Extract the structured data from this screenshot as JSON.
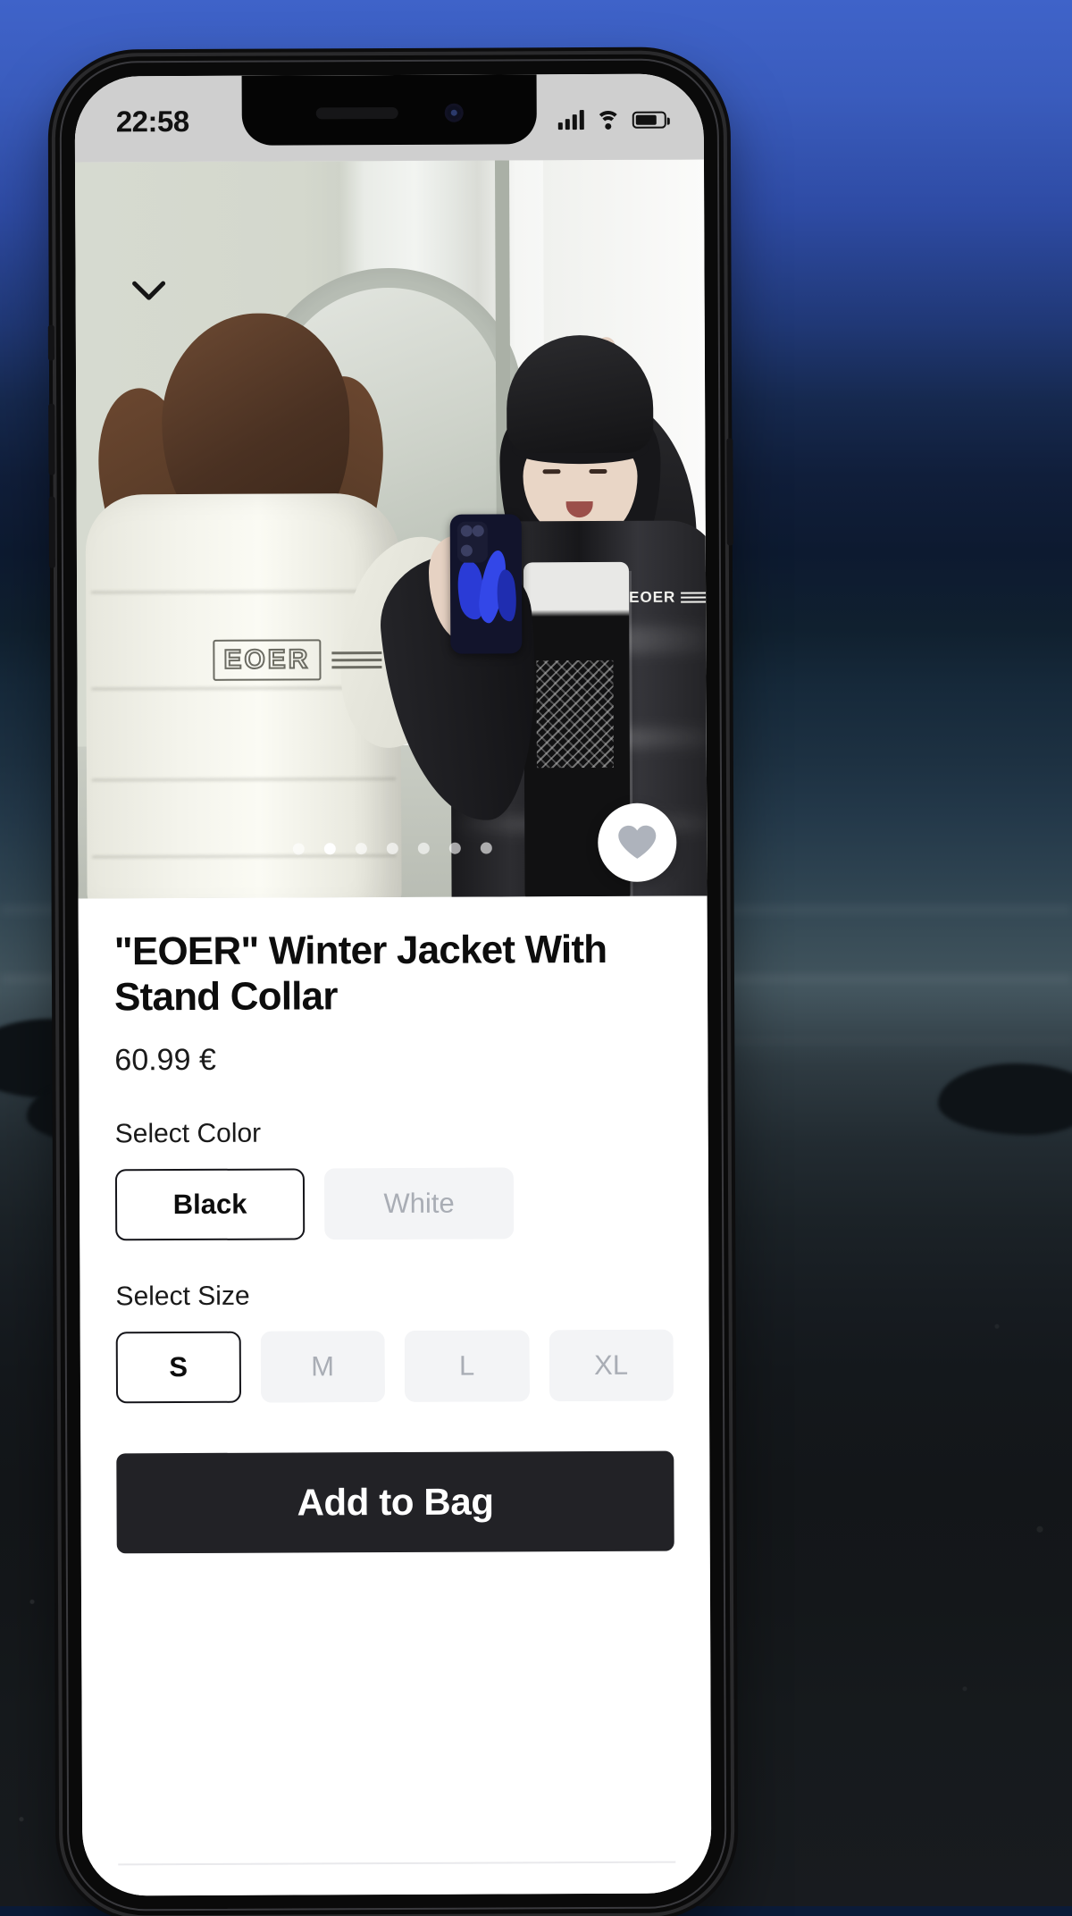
{
  "status_bar": {
    "time": "22:58",
    "signal_icon": "cellular-signal-icon",
    "wifi_icon": "wifi-icon",
    "battery_icon": "battery-icon"
  },
  "hero": {
    "back_icon": "chevron-down-icon",
    "favorite_icon": "heart-icon",
    "carousel": {
      "total": 7,
      "active_index": 1
    }
  },
  "product": {
    "title": "\"EOER\" Winter Jacket With Stand Collar",
    "price": "60.99 €",
    "brand_mark": "EOER",
    "color": {
      "label": "Select Color",
      "options": [
        {
          "label": "Black",
          "selected": true
        },
        {
          "label": "White",
          "selected": false
        }
      ]
    },
    "size": {
      "label": "Select Size",
      "options": [
        {
          "label": "S",
          "selected": true
        },
        {
          "label": "M",
          "selected": false
        },
        {
          "label": "L",
          "selected": false
        },
        {
          "label": "XL",
          "selected": false
        }
      ]
    },
    "cta": "Add to Bag"
  },
  "colors": {
    "cta_background": "#222226",
    "selected_border": "#15151a",
    "unselected_background": "#f3f4f6",
    "unselected_text": "#a9adb5",
    "page_background": "#ffffff",
    "status_bar_background": "#cfcfcf"
  }
}
